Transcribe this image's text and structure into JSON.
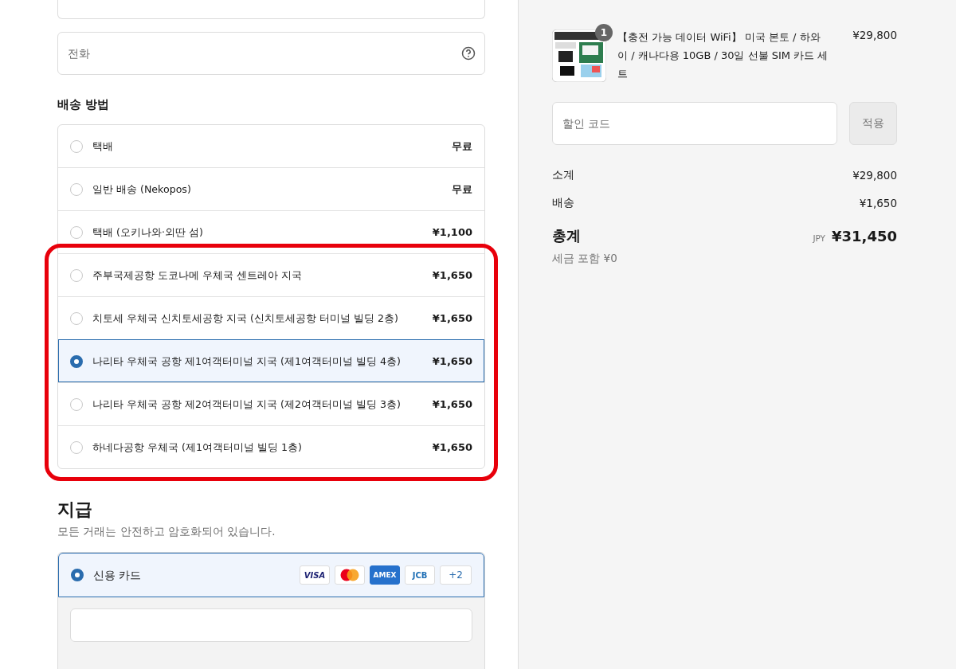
{
  "contact": {
    "phone_placeholder": "전화"
  },
  "shipping": {
    "title": "배송 방법",
    "options": [
      {
        "label": "택배",
        "price": "무료",
        "selected": false,
        "highlighted": false
      },
      {
        "label": "일반 배송 (Nekopos)",
        "price": "무료",
        "selected": false,
        "highlighted": false
      },
      {
        "label": "택배 (오키나와·외딴 섬)",
        "price": "¥1,100",
        "selected": false,
        "highlighted": false
      },
      {
        "label": "주부국제공항 도코나메 우체국 센트레아 지국",
        "price": "¥1,650",
        "selected": false,
        "highlighted": true
      },
      {
        "label": "치토세 우체국 신치토세공항 지국 (신치토세공항 터미널 빌딩 2층)",
        "price": "¥1,650",
        "selected": false,
        "highlighted": true
      },
      {
        "label": "나리타 우체국 공항 제1여객터미널 지국 (제1여객터미널 빌딩 4층)",
        "price": "¥1,650",
        "selected": true,
        "highlighted": true
      },
      {
        "label": "나리타 우체국 공항 제2여객터미널 지국 (제2여객터미널 빌딩 3층)",
        "price": "¥1,650",
        "selected": false,
        "highlighted": true
      },
      {
        "label": "하네다공항 우체국 (제1여객터미널 빌딩 1층)",
        "price": "¥1,650",
        "selected": false,
        "highlighted": true
      }
    ]
  },
  "payment": {
    "title": "지급",
    "subtitle": "모든 거래는 안전하고 암호화되어 있습니다.",
    "methods": [
      {
        "label": "신용 카드",
        "selected": true,
        "cards": [
          {
            "kind": "visa",
            "label": "VISA"
          },
          {
            "kind": "mastercard"
          },
          {
            "kind": "amex",
            "label": "AMEX"
          },
          {
            "kind": "jcb",
            "label": "JCB"
          }
        ],
        "more": "+2"
      }
    ]
  },
  "summary": {
    "product": {
      "name": "【충전 가능 데이터 WiFi】 미국 본토 / 하와이 / 캐나다용 10GB / 30일 선불 SIM 카드 세트",
      "price": "¥29,800",
      "quantity": "1"
    },
    "discount_placeholder": "할인 코드",
    "apply": "적용",
    "lines": [
      {
        "label": "소계",
        "value": "¥29,800"
      },
      {
        "label": "배송",
        "value": "¥1,650"
      }
    ],
    "total": {
      "label": "총계",
      "currency": "JPY",
      "value": "¥31,450"
    },
    "tax": "세금 포함 ¥0"
  }
}
